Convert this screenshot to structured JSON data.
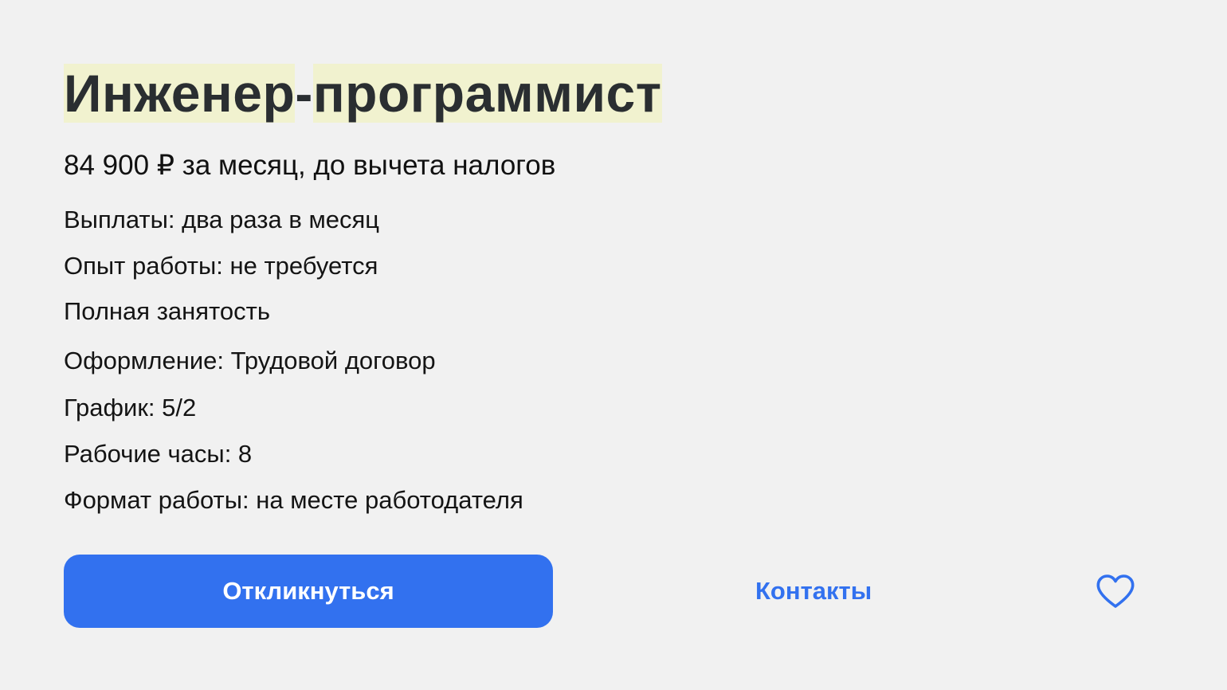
{
  "vacancy": {
    "title_part1": "Инженер",
    "title_dash": "-",
    "title_part2": "программист",
    "salary": "84 900 ₽ за месяц, до вычета налогов",
    "details": [
      "Выплаты: два раза в месяц",
      "Опыт работы: не требуется",
      "Полная занятость",
      "Оформление: Трудовой договор",
      "График: 5/2",
      "Рабочие часы: 8",
      "Формат работы: на месте работодателя"
    ]
  },
  "actions": {
    "apply_label": "Откликнуться",
    "contacts_label": "Контакты",
    "favorite_icon": "heart-icon"
  },
  "colors": {
    "accent": "#3271ef",
    "highlight": "#f1f2cf",
    "background": "#f1f1f1"
  }
}
